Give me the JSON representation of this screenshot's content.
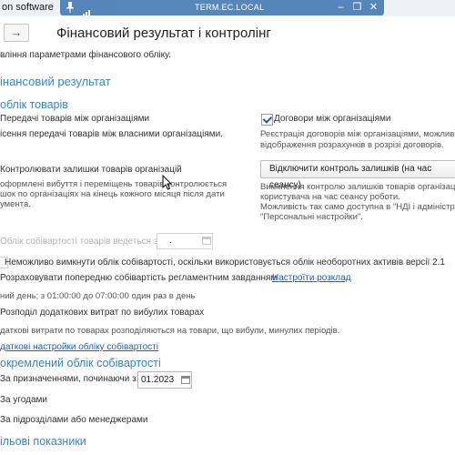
{
  "window": {
    "app_title": "on software",
    "host": "TERM.EC.LOCAL"
  },
  "colors": {
    "heading": "#3a85c8",
    "link": "#1f5fbf",
    "rdp_bar": "#4a7db4"
  },
  "page": {
    "title": "Фінансовий результат і контролінг",
    "subtitle": "вління параметрами фінансового обліку."
  },
  "section_fin": {
    "title": "інансовий результат"
  },
  "goods": {
    "title": "облік товарів",
    "transfer_label": "Передачі товарів між організаціями",
    "transfer_desc": "ісення передачі товарів між власними організаціями.",
    "contracts_label": "Договори між організаціями",
    "contracts_desc_1": "Реєстрація договорів між організаціями, можливі",
    "contracts_desc_2": "відображення розрахунків в розрізі договорів.",
    "control_label": "Контролювати залишки товарів організацій",
    "control_desc_1": "оформлені вибуття і переміщень товарів контролюється",
    "control_desc_2": "шок по організаціях на кінець кожного місяця після дати",
    "control_desc_3": "умента.",
    "disable_button": "Відключити контроль залишків (на час сеансу)",
    "disable_desc_1": "Вимкнення контролю залишків товарів організаці",
    "disable_desc_2": "користувача на час сеансу роботи.",
    "disable_desc_3": "Можливість так само доступна в \"НДІ і адміністр",
    "disable_desc_4": "\"Персональні настройки\"."
  },
  "cost": {
    "since_label": "Облік собівартості товарів ведеться з",
    "since_value": ".",
    "warning": "Неможливо вимкнути облік собівартості, оскільки використовується облік необоротних активів версії 2.1",
    "precalc_label": "Розраховувати попередню собівартість регламентним завданням",
    "schedule_link": "Настроїти розклад",
    "schedule_text": "ний день; з 01:00:00 до 07:00:00 один раз в день",
    "distribute_label": "Розподіл додаткових витрат по вибулих товарах",
    "distribute_desc": "даткові витрати по товарах розподіляються на товари, що вибули, минулих періодів.",
    "extra_link": "даткові настройки обліку собівартості"
  },
  "separate": {
    "title": "окремлений облік собівартості",
    "by_purpose_label": "За призначеннями, починаючи з:",
    "by_purpose_date": "01.2023",
    "by_contracts_label": "За угодами",
    "by_departments_label": "За підрозділами або менеджерами"
  },
  "targets": {
    "title": "ільові показники"
  },
  "checks": {
    "transfer": false,
    "contracts": true,
    "control": false,
    "precalc": false,
    "distribute": false,
    "by_purpose": false,
    "by_contracts": false,
    "by_departments": false
  }
}
